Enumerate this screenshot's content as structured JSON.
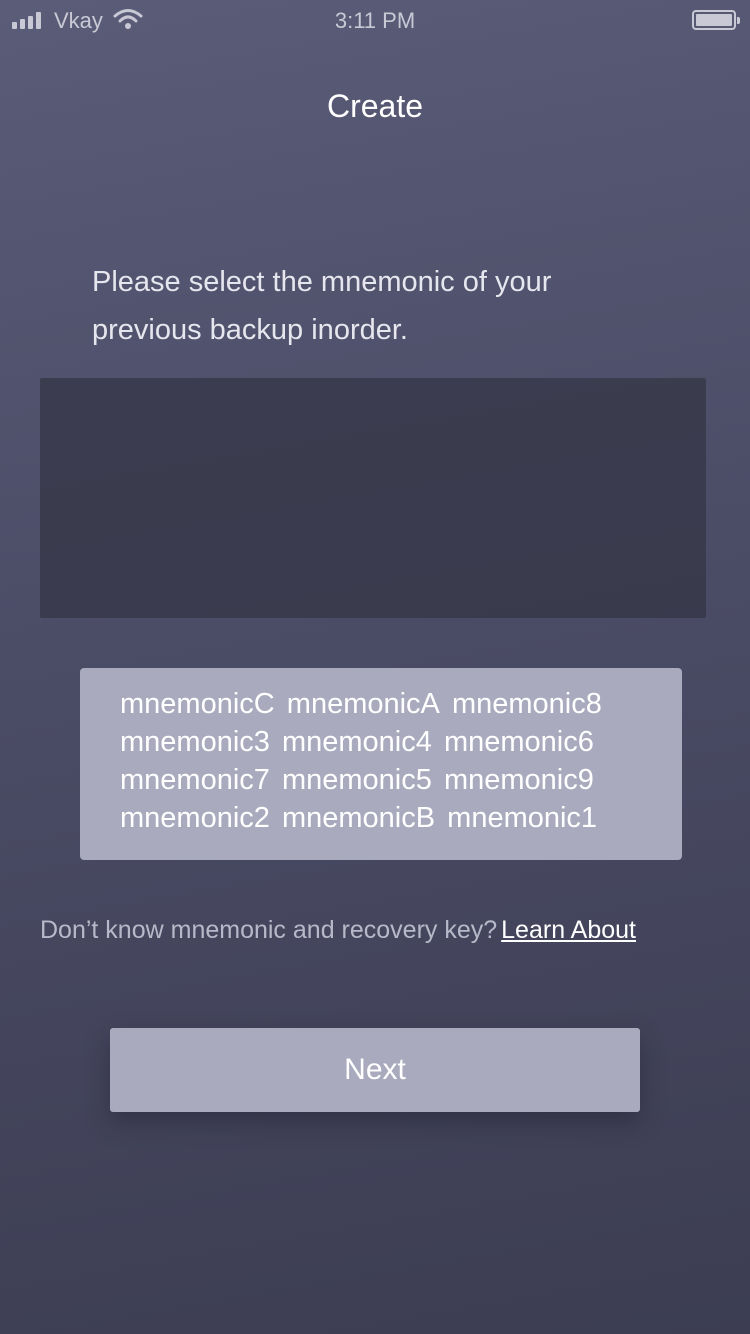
{
  "status_bar": {
    "carrier": "Vkay",
    "time": "3:11 PM",
    "icons": [
      "signal-icon",
      "wifi-icon",
      "battery-icon"
    ]
  },
  "header": {
    "title": "Create"
  },
  "instruction": {
    "text": "Please select the mnemonic of your previous backup inorder."
  },
  "mnemonic_words": [
    [
      "mnemonicC",
      "mnemonicA",
      "mnemonic8"
    ],
    [
      "mnemonic3",
      "mnemonic4",
      "mnemonic6"
    ],
    [
      "mnemonic7",
      "mnemonic5",
      "mnemonic9"
    ],
    [
      "mnemonic2",
      "mnemonicB",
      "mnemonic1"
    ]
  ],
  "help": {
    "text": "Don’t know mnemonic and recovery key?",
    "link_label": "Learn About"
  },
  "actions": {
    "next_label": "Next"
  },
  "colors": {
    "background_top": "#5a5c78",
    "background_bottom": "#3c3d52",
    "word_box": "#a9aabd",
    "button": "#a9aabd",
    "selected_area": "#3a3b4e",
    "link": "#ffffff"
  }
}
